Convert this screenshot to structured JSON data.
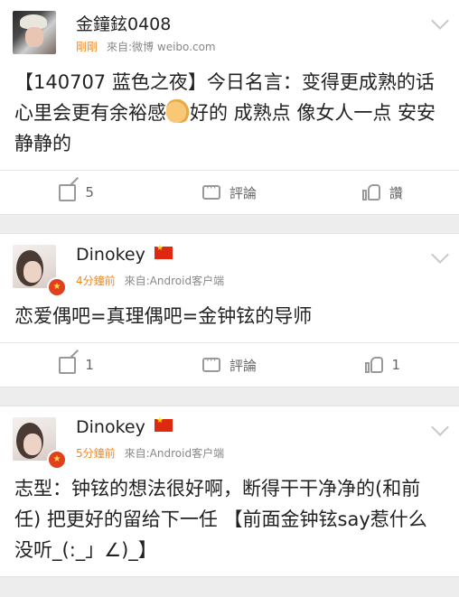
{
  "posts": [
    {
      "author": "金鐘鉉0408",
      "time": "剛剛",
      "source": "來自:微博 weibo.com",
      "content_before_emoji": "【140707 蓝色之夜】今日名言：变得更成熟的话 心里会更有余裕感",
      "content_after_emoji": "好的 成熟点 像女人一点 安安静静的",
      "forward_count": "5",
      "comment_label": "評論",
      "like_label": "讚"
    },
    {
      "author": "Dinokey",
      "time": "4分鐘前",
      "source": "來自:Android客户端",
      "content": "恋爱偶吧=真理偶吧=金钟铉的导师",
      "forward_count": "1",
      "comment_label": "評論",
      "like_count": "1"
    },
    {
      "author": "Dinokey",
      "time": "5分鐘前",
      "source": "來自:Android客户端",
      "content": "志型：钟铉的想法很好啊，断得干干净净的(和前任) 把更好的留给下一任 【前面金钟铉say惹什么没听_(:_」∠)_】"
    }
  ],
  "icons": {
    "forward": "forward-icon",
    "comment": "comment-icon",
    "like": "like-icon",
    "dropdown": "chevron-down-icon",
    "verified": "verified-badge-icon",
    "flag": "china-flag-icon",
    "emoji": "ok-hand-emoji"
  },
  "colors": {
    "time_accent": "#f08a24",
    "background": "#ededed",
    "verified": "#e0401c"
  }
}
